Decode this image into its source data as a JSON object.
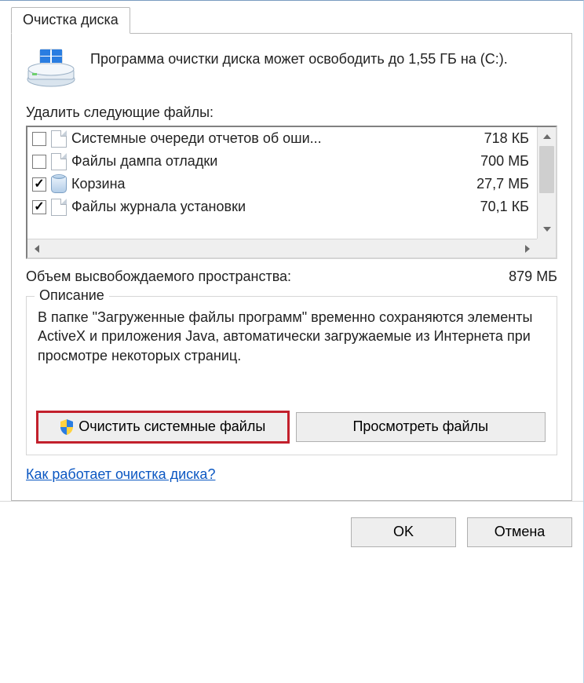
{
  "tab": {
    "label": "Очистка диска"
  },
  "intro": "Программа очистки диска может освободить до 1,55 ГБ на  (C:).",
  "list_label": "Удалить следующие файлы:",
  "files": [
    {
      "checked": false,
      "icon": "doc",
      "name": "Системные очереди отчетов об оши...",
      "size": "718 КБ"
    },
    {
      "checked": false,
      "icon": "doc",
      "name": "Файлы дампа отладки",
      "size": "700 МБ"
    },
    {
      "checked": true,
      "icon": "bin",
      "name": "Корзина",
      "size": "27,7 МБ"
    },
    {
      "checked": true,
      "icon": "doc",
      "name": "Файлы журнала установки",
      "size": "70,1 КБ"
    }
  ],
  "freed": {
    "label": "Объем высвобождаемого пространства:",
    "value": "879 МБ"
  },
  "description": {
    "legend": "Описание",
    "text": "В папке \"Загруженные файлы программ\" временно сохраняются элементы ActiveX и приложения Java, автоматически загружаемые из Интернета при просмотре некоторых страниц."
  },
  "buttons": {
    "clean_system": "Очистить системные файлы",
    "view_files": "Просмотреть файлы",
    "ok": "OK",
    "cancel": "Отмена"
  },
  "help_link": "Как работает очистка диска?"
}
